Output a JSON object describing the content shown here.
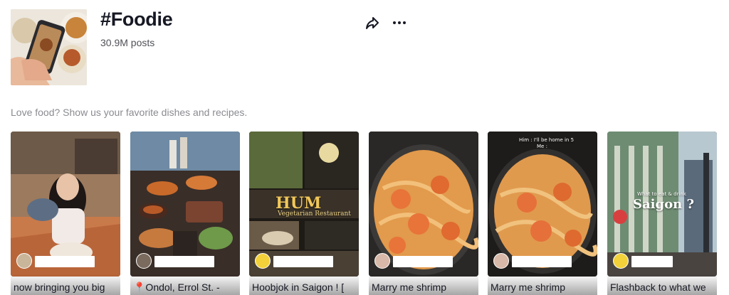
{
  "tag": {
    "title": "#Foodie",
    "posts": "30.9M posts",
    "description": "Love food? Show us your favorite dishes and recipes."
  },
  "actions": {
    "share_icon": "share-icon",
    "more_icon": "more-icon"
  },
  "videos": [
    {
      "caption": "now bringing you big",
      "overlay": []
    },
    {
      "caption": "📍Ondol, Errol St. -",
      "overlay": []
    },
    {
      "caption": "Hoobjok in Saigon ! [",
      "overlay": [
        "HUM",
        "Vegetarian Restaurant"
      ]
    },
    {
      "caption": "Marry me shrimp",
      "overlay": []
    },
    {
      "caption": "Marry me shrimp",
      "overlay": [
        "Him : I'll be home in 5",
        "Me :"
      ]
    },
    {
      "caption": "Flashback to what we",
      "overlay": [
        "What to eat & drink",
        "Saigon ?"
      ]
    }
  ],
  "colors": {
    "text": "#161823",
    "secondary": "#8a8b91",
    "background": "#ffffff"
  }
}
